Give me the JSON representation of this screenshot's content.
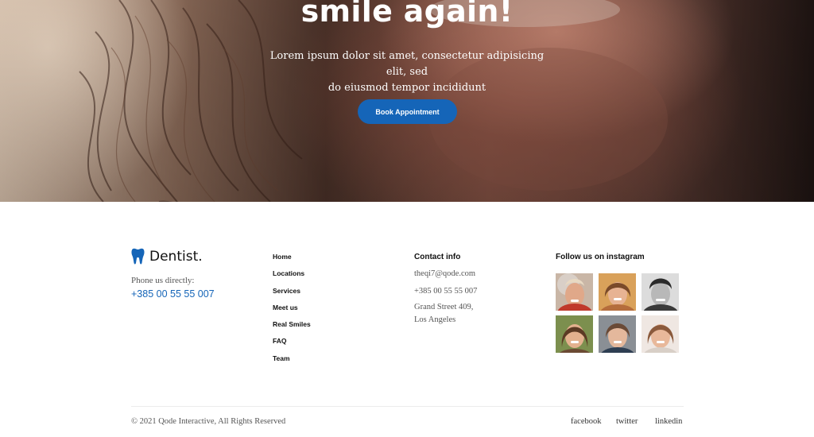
{
  "hero": {
    "title": "smile again!",
    "subtitle_line1": "Lorem ipsum dolor sit amet, consectetur adipisicing elit, sed",
    "subtitle_line2": "do eiusmod tempor incididunt",
    "cta_label": "Book Appointment"
  },
  "brand": {
    "name": "Dentist.",
    "logo_icon": "tooth-icon",
    "accent_color": "#1565b8"
  },
  "contact_left": {
    "phone_label": "Phone us directly:",
    "phone_number": "+385 00 55 55 007"
  },
  "nav": {
    "items": [
      "Home",
      "Locations",
      "Services",
      "Meet us",
      "Real Smiles",
      "FAQ",
      "Team"
    ]
  },
  "contact_info": {
    "heading": "Contact info",
    "email": "theqi7@qode.com",
    "phone": "+385 00 55 55 007",
    "address_line1": "Grand Street 409,",
    "address_line2": "Los Angeles"
  },
  "instagram": {
    "heading": "Follow us on instagram",
    "photos": [
      "instagram-photo-1",
      "instagram-photo-2",
      "instagram-photo-3",
      "instagram-photo-4",
      "instagram-photo-5",
      "instagram-photo-6"
    ]
  },
  "footer": {
    "copyright": "© 2021 Qode Interactive, All Rights Reserved",
    "social": [
      "facebook",
      "twitter",
      "linkedin"
    ]
  }
}
